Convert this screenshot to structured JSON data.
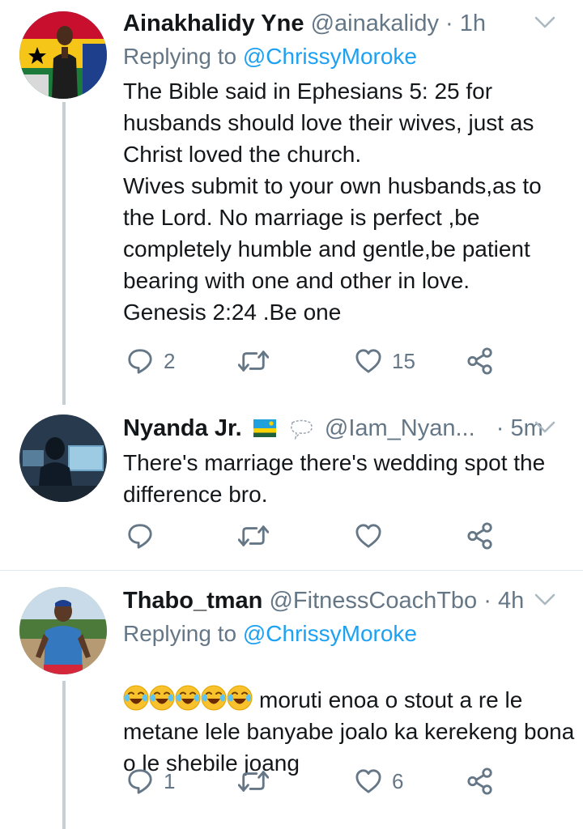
{
  "tweets": [
    {
      "name": "Ainakhalidy Yne",
      "handle": "@ainakalidy",
      "dot": "·",
      "time": "1h",
      "replying_prefix": "Replying to ",
      "replying_mention": "@ChrissyMoroke",
      "text": "The Bible said in Ephesians 5: 25 for husbands should love their wives, just as Christ loved the church.\nWives submit to your own husbands,as to the Lord. No marriage is perfect ,be completely humble and gentle,be patient bearing with one and other in love.\nGenesis 2:24 .Be one",
      "reply_count": "2",
      "retweet_count": "",
      "like_count": "15"
    },
    {
      "name": "Nyanda Jr.",
      "handle": "@Iam_Nyan...",
      "dot": "·",
      "time": "5m",
      "text": "There's marriage there's wedding spot the difference bro.",
      "reply_count": "",
      "retweet_count": "",
      "like_count": ""
    },
    {
      "name": "Thabo_tman",
      "handle": "@FitnessCoachTbo",
      "dot": "·",
      "time": "4h",
      "replying_prefix": "Replying to ",
      "replying_mention": "@ChrissyMoroke",
      "text": "moruti enoa o stout a re le metane lele banyabe joalo ka kerekeng bona o le shebile joang",
      "reply_count": "1",
      "retweet_count": "",
      "like_count": "6"
    }
  ],
  "colors": {
    "accent": "#1da1f2",
    "secondary_text": "#657786",
    "thread_line": "#c4cfd6",
    "divider": "#e1e8ed"
  }
}
